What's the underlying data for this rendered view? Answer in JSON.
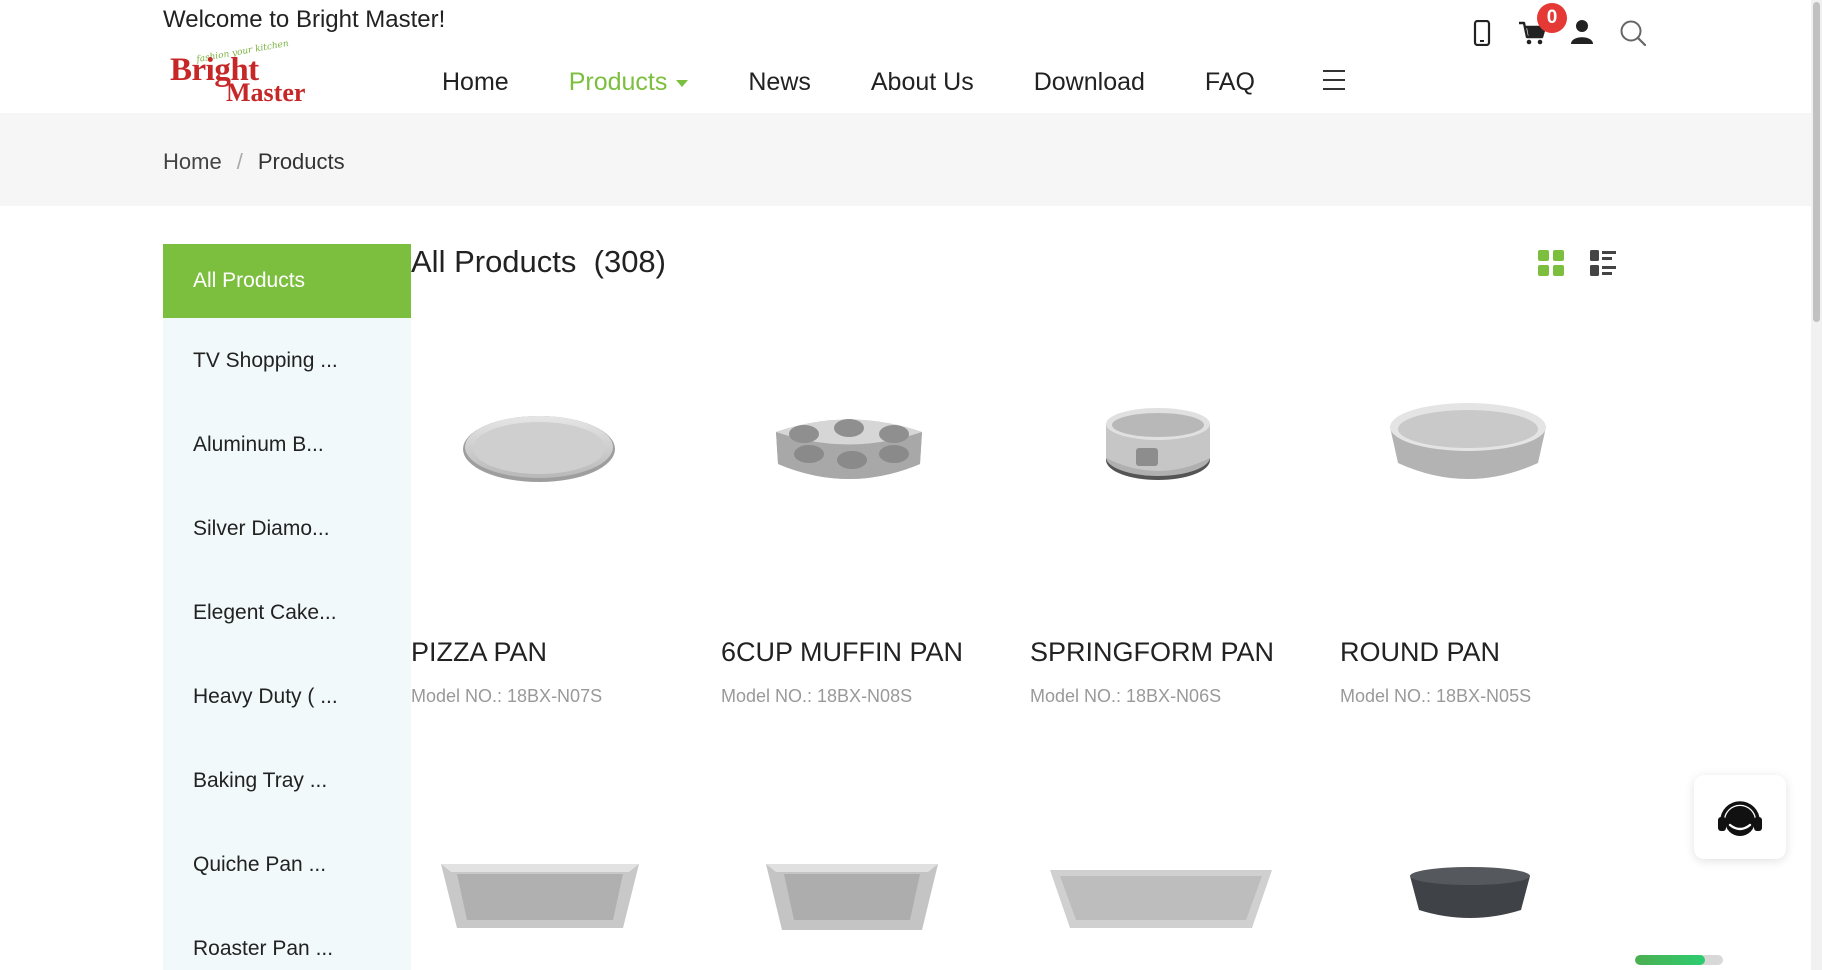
{
  "header": {
    "welcome": "Welcome to Bright Master!",
    "logo": {
      "word1": "Bright",
      "word2": "Master",
      "tagline": "fashion your kitchen"
    },
    "nav": [
      {
        "label": "Home",
        "active": false
      },
      {
        "label": "Products",
        "active": true
      },
      {
        "label": "News",
        "active": false
      },
      {
        "label": "About Us",
        "active": false
      },
      {
        "label": "Download",
        "active": false
      },
      {
        "label": "FAQ",
        "active": false
      }
    ],
    "cart_count": "0",
    "icons": [
      "mobile-phone-icon",
      "cart-icon",
      "user-icon",
      "search-icon",
      "menu-icon"
    ]
  },
  "breadcrumb": {
    "home": "Home",
    "separator": "/",
    "current": "Products"
  },
  "sidebar": {
    "items": [
      "All Products",
      "TV Shopping ...",
      "Aluminum B...",
      "Silver Diamo...",
      "Elegent Cake...",
      "Heavy Duty ( ...",
      "Baking Tray ...",
      "Quiche Pan ...",
      "Roaster Pan ..."
    ],
    "active_index": 0
  },
  "main": {
    "title": "All Products  (308)",
    "products": [
      {
        "name": "PIZZA PAN",
        "model": "Model NO.:  18BX-N07S"
      },
      {
        "name": "6CUP MUFFIN PAN",
        "model": "Model NO.:  18BX-N08S"
      },
      {
        "name": "SPRINGFORM PAN",
        "model": "Model NO.:  18BX-N06S"
      },
      {
        "name": "ROUND PAN",
        "model": "Model NO.:  18BX-N05S"
      }
    ]
  },
  "widgets": {
    "chat_icon": "headset-icon",
    "progress_fraction": 0.8
  },
  "colors": {
    "accent": "#7cbf3f",
    "badge": "#e53935",
    "sidebar_bg": "#f1f9fb",
    "crumb_bg": "#f6f6f6"
  }
}
